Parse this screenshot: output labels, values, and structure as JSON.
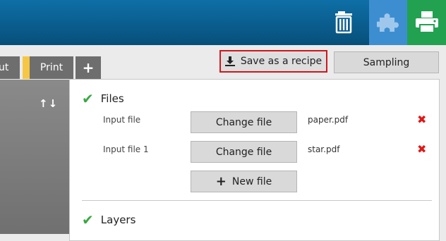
{
  "header": {
    "icons": [
      "trash-icon",
      "puzzle-icon",
      "printer-icon"
    ],
    "colors": {
      "bar": "#0a5d8e",
      "puzzle_bg": "#3d8ed1",
      "printer_bg": "#22a251"
    }
  },
  "tabs": [
    {
      "label": "ut"
    },
    {
      "label": "Print",
      "marker_color": "#f6c744"
    },
    {
      "label": "+"
    }
  ],
  "toolbar": {
    "save_recipe_label": "Save as a recipe",
    "sampling_label": "Sampling"
  },
  "left_panel": {
    "arrows": "↑↓"
  },
  "files_section": {
    "title": "Files",
    "rows": [
      {
        "label": "Input file",
        "button": "Change file",
        "filename": "paper.pdf",
        "remove": "✖"
      },
      {
        "label": "Input file 1",
        "button": "Change file",
        "filename": "star.pdf",
        "remove": "✖"
      }
    ],
    "new_file_label": "New file"
  },
  "layers_section": {
    "title": "Layers"
  },
  "check_glyph": "✔"
}
